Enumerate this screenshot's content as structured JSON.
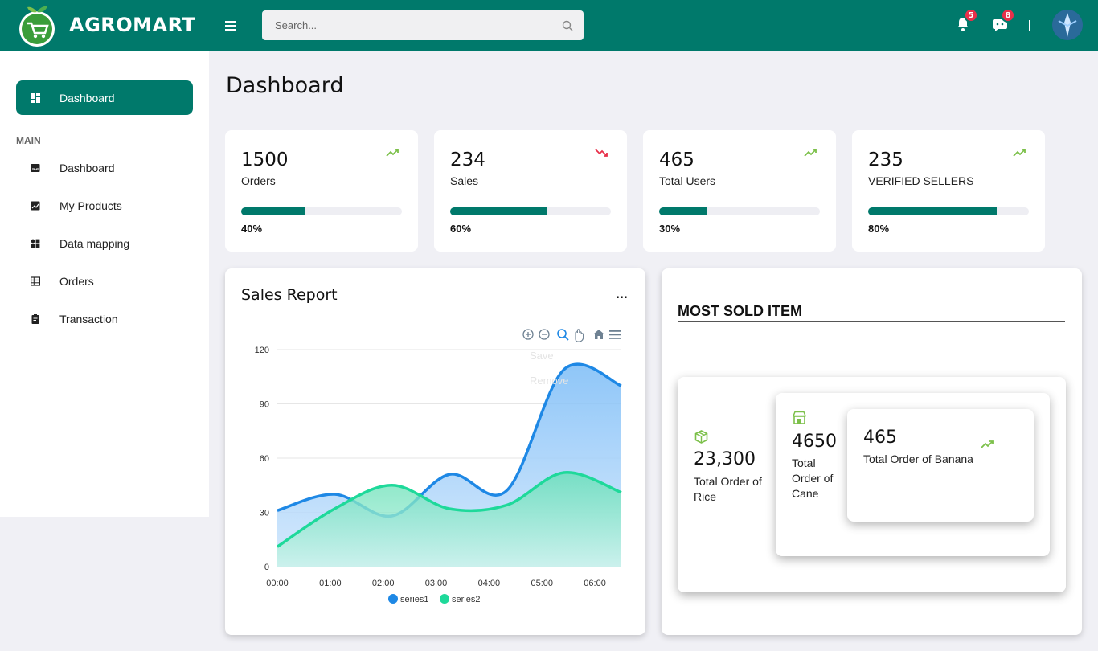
{
  "app": {
    "brand": "AGROMART"
  },
  "header": {
    "search_placeholder": "Search...",
    "notifications_count": "5",
    "messages_count": "8"
  },
  "sidebar": {
    "active_label": "Dashboard",
    "section_label": "MAIN",
    "items": [
      {
        "label": "Dashboard",
        "icon": "inbox-icon"
      },
      {
        "label": "My Products",
        "icon": "chart-icon"
      },
      {
        "label": "Data mapping",
        "icon": "apps-icon"
      },
      {
        "label": "Orders",
        "icon": "table-icon"
      },
      {
        "label": "Transaction",
        "icon": "clipboard-icon"
      }
    ]
  },
  "page": {
    "title": "Dashboard"
  },
  "stats": [
    {
      "value": "1500",
      "label": "Orders",
      "percent": "40%",
      "progress": 0.4,
      "trend": "up"
    },
    {
      "value": "234",
      "label": "Sales",
      "percent": "60%",
      "progress": 0.6,
      "trend": "down"
    },
    {
      "value": "465",
      "label": "Total Users",
      "percent": "30%",
      "progress": 0.3,
      "trend": "up"
    },
    {
      "value": "235",
      "label": "VERIFIED SELLERS",
      "percent": "80%",
      "progress": 0.8,
      "trend": "up"
    }
  ],
  "sales_report": {
    "title": "Sales Report",
    "menu_label": "...",
    "toolbar_menu": {
      "save": "Save",
      "remove": "Remove"
    }
  },
  "most_sold": {
    "title": "MOST SOLD ITEM",
    "items": [
      {
        "value": "23,300",
        "label": "Total Order of Rice"
      },
      {
        "value": "4650",
        "label": "Total Order of Cane"
      },
      {
        "value": "465",
        "label": "Total Order of Banana"
      }
    ]
  },
  "colors": {
    "primary": "#00796b",
    "series1": "#1e88e5",
    "series2": "#1ed99a",
    "trend_up": "#7cc04a",
    "trend_down": "#e8304a"
  },
  "chart_data": {
    "type": "area",
    "x": [
      "00:00",
      "01:00",
      "02:00",
      "03:00",
      "04:00",
      "05:00",
      "06:00"
    ],
    "x_values": [
      0,
      0.66,
      1.33,
      2,
      2.66,
      3.33,
      4,
      4.66,
      5.33,
      6,
      6.5
    ],
    "series": [
      {
        "name": "series1",
        "values": [
          31,
          40,
          28,
          51,
          42,
          109,
          100
        ]
      },
      {
        "name": "series2",
        "values": [
          11,
          32,
          45,
          32,
          34,
          52,
          41
        ]
      }
    ],
    "ylim": [
      0,
      120
    ],
    "yticks": [
      "0",
      "30",
      "60",
      "90",
      "120"
    ],
    "legend_position": "bottom",
    "grid": true
  }
}
